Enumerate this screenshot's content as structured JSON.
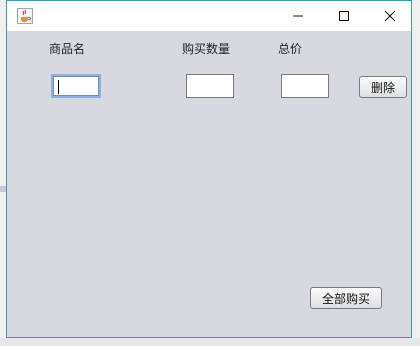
{
  "window": {
    "icon": "java-cup-icon",
    "controls": {
      "minimize": "minimize-icon",
      "maximize": "maximize-icon",
      "close": "close-icon"
    }
  },
  "form": {
    "label_product": "商品名",
    "label_quantity": "购买数量",
    "label_total": "总价",
    "product_value": "",
    "quantity_value": "",
    "total_value": "",
    "delete_label": "删除",
    "buy_all_label": "全部购买"
  }
}
